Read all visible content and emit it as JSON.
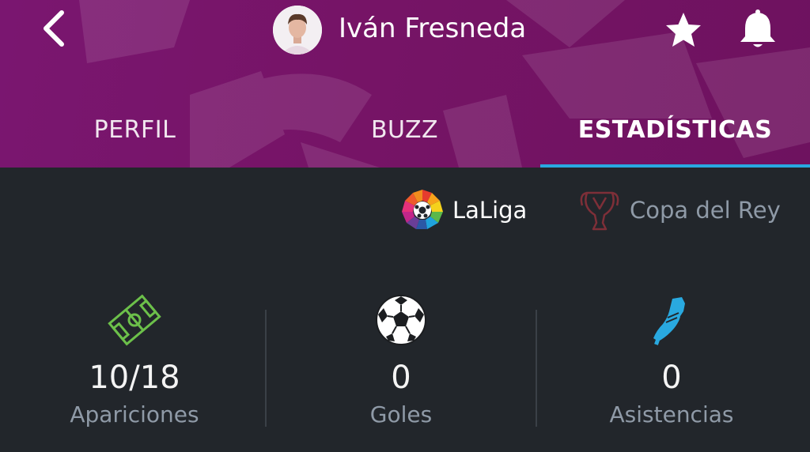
{
  "header": {
    "player_name": "Iván Fresneda",
    "back_icon": "chevron-left-icon",
    "favorite_icon": "star-icon",
    "notifications_icon": "bell-icon",
    "background_color": "#761466"
  },
  "tabs": [
    {
      "label": "PERFIL",
      "active": false
    },
    {
      "label": "BUZZ",
      "active": false
    },
    {
      "label": "ESTADÍSTICAS",
      "active": true
    }
  ],
  "competitions": [
    {
      "label": "LaLiga",
      "selected": true,
      "color": "#ffffff"
    },
    {
      "label": "Copa del Rey",
      "selected": false,
      "color": "#8f9aa7"
    }
  ],
  "stats": [
    {
      "icon": "pitch-icon",
      "value": "10/18",
      "label": "Apariciones",
      "icon_color": "#6cc04a"
    },
    {
      "icon": "soccer-ball-icon",
      "value": "0",
      "label": "Goles",
      "icon_color": "#ffffff"
    },
    {
      "icon": "boot-icon",
      "value": "0",
      "label": "Asistencias",
      "icon_color": "#29a9e0"
    }
  ],
  "colors": {
    "accent": "#29a9e0",
    "background": "#22262b"
  }
}
